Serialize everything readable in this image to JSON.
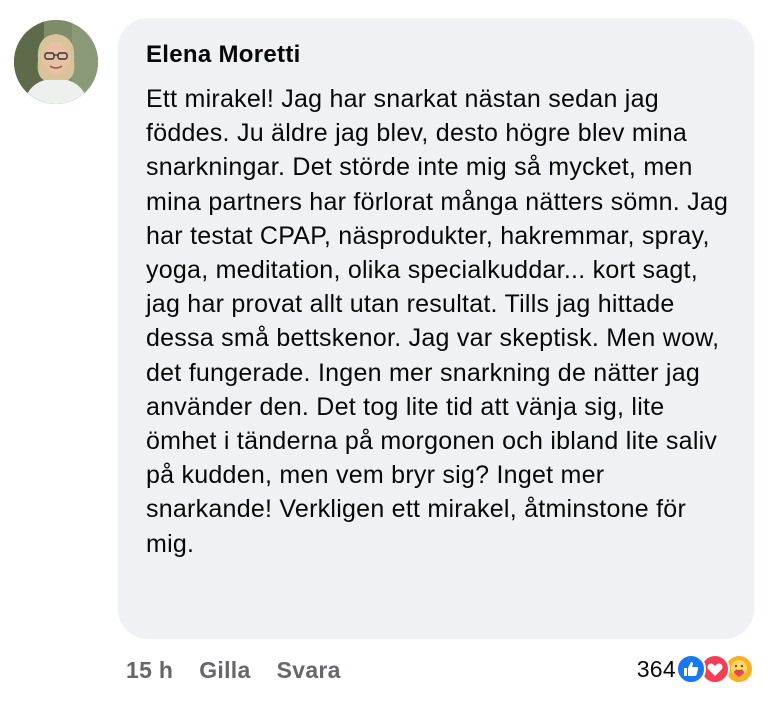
{
  "comment": {
    "author": "Elena Moretti",
    "text": "Ett mirakel! Jag har snarkat nästan sedan jag föddes. Ju äldre jag blev, desto högre blev mina snarkningar. Det störde inte mig så mycket, men mina partners har förlorat många nätters sömn. Jag har testat CPAP, näsprodukter, hakremmar, spray, yoga, meditation, olika specialkuddar... kort sagt, jag har provat allt utan resultat. Tills jag hittade dessa små bettskenor. Jag var skeptisk. Men wow, det fungerade. Ingen mer snarkning de nätter jag använder den. Det tog lite tid att vänja sig, lite ömhet i tänderna på morgonen och ibland lite saliv på kudden, men vem bryr sig? Inget mer snarkande! Verkligen ett mirakel, åtminstone för mig."
  },
  "actions": {
    "time": "15 h",
    "like_label": "Gilla",
    "reply_label": "Svara"
  },
  "reactions": {
    "count": "364",
    "icons": [
      "like-icon",
      "love-icon",
      "care-icon"
    ],
    "colors": {
      "like": "#1877f2",
      "love": "#f33e58",
      "care": "#f7b125"
    }
  }
}
